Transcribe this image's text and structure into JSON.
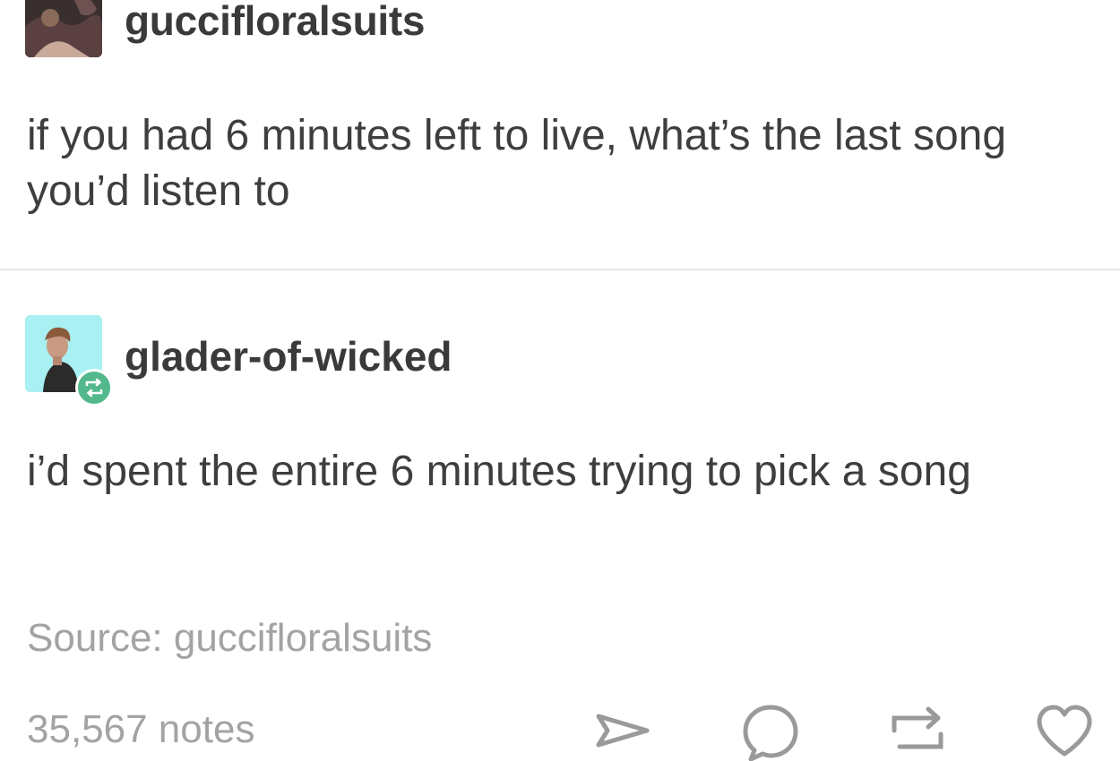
{
  "post": {
    "username": "guccifloralsuits",
    "text": "if you had 6 minutes left to live, what’s the last song you’d listen to"
  },
  "reblog": {
    "username": "glader-of-wicked",
    "text": "i’d spent the entire 6 minutes trying to pick a song"
  },
  "footer": {
    "source": "Source: guccifloralsuits",
    "notes": "35,567 notes"
  },
  "actions": {
    "icons": [
      "share-icon",
      "reply-icon",
      "reblog-icon",
      "like-icon"
    ]
  },
  "colors": {
    "reblog_badge": "#53b88b",
    "reblog_avatar_bg": "#a9f0f2",
    "muted_text": "#a3a3a3",
    "divider": "#e6e6e6"
  }
}
